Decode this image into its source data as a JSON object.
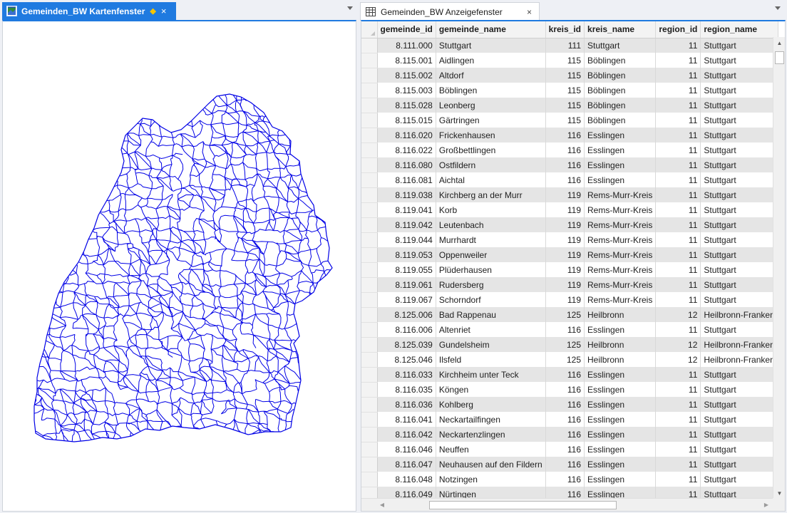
{
  "map_panel": {
    "tab_title": "Gemeinden_BW Kartenfenster",
    "icons": {
      "tab_icon": "map-window-icon",
      "modified": "diamond-icon",
      "close": "close-icon",
      "menu": "chevron-down-icon"
    },
    "close_glyph": "×",
    "pin_glyph": "◆",
    "colors": {
      "tab_active_bg": "#1f7ae0",
      "boundary_stroke": "#0000e6",
      "pin": "#f5c400"
    }
  },
  "table_panel": {
    "tab_title": "Gemeinden_BW Anzeigefenster",
    "icons": {
      "tab_icon": "table-icon",
      "close": "close-icon",
      "menu": "chevron-down-icon"
    },
    "close_glyph": "×",
    "columns": [
      "gemeinde_id",
      "gemeinde_name",
      "kreis_id",
      "kreis_name",
      "region_id",
      "region_name"
    ],
    "rows": [
      [
        "8.111.000",
        "Stuttgart",
        "111",
        "Stuttgart",
        "11",
        "Stuttgart"
      ],
      [
        "8.115.001",
        "Aidlingen",
        "115",
        "Böblingen",
        "11",
        "Stuttgart"
      ],
      [
        "8.115.002",
        "Altdorf",
        "115",
        "Böblingen",
        "11",
        "Stuttgart"
      ],
      [
        "8.115.003",
        "Böblingen",
        "115",
        "Böblingen",
        "11",
        "Stuttgart"
      ],
      [
        "8.115.028",
        "Leonberg",
        "115",
        "Böblingen",
        "11",
        "Stuttgart"
      ],
      [
        "8.115.015",
        "Gärtringen",
        "115",
        "Böblingen",
        "11",
        "Stuttgart"
      ],
      [
        "8.116.020",
        "Frickenhausen",
        "116",
        "Esslingen",
        "11",
        "Stuttgart"
      ],
      [
        "8.116.022",
        "Großbettlingen",
        "116",
        "Esslingen",
        "11",
        "Stuttgart"
      ],
      [
        "8.116.080",
        "Ostfildern",
        "116",
        "Esslingen",
        "11",
        "Stuttgart"
      ],
      [
        "8.116.081",
        "Aichtal",
        "116",
        "Esslingen",
        "11",
        "Stuttgart"
      ],
      [
        "8.119.038",
        "Kirchberg an der Murr",
        "119",
        "Rems-Murr-Kreis",
        "11",
        "Stuttgart"
      ],
      [
        "8.119.041",
        "Korb",
        "119",
        "Rems-Murr-Kreis",
        "11",
        "Stuttgart"
      ],
      [
        "8.119.042",
        "Leutenbach",
        "119",
        "Rems-Murr-Kreis",
        "11",
        "Stuttgart"
      ],
      [
        "8.119.044",
        "Murrhardt",
        "119",
        "Rems-Murr-Kreis",
        "11",
        "Stuttgart"
      ],
      [
        "8.119.053",
        "Oppenweiler",
        "119",
        "Rems-Murr-Kreis",
        "11",
        "Stuttgart"
      ],
      [
        "8.119.055",
        "Plüderhausen",
        "119",
        "Rems-Murr-Kreis",
        "11",
        "Stuttgart"
      ],
      [
        "8.119.061",
        "Rudersberg",
        "119",
        "Rems-Murr-Kreis",
        "11",
        "Stuttgart"
      ],
      [
        "8.119.067",
        "Schorndorf",
        "119",
        "Rems-Murr-Kreis",
        "11",
        "Stuttgart"
      ],
      [
        "8.125.006",
        "Bad Rappenau",
        "125",
        "Heilbronn",
        "12",
        "Heilbronn-Franken"
      ],
      [
        "8.116.006",
        "Altenriet",
        "116",
        "Esslingen",
        "11",
        "Stuttgart"
      ],
      [
        "8.125.039",
        "Gundelsheim",
        "125",
        "Heilbronn",
        "12",
        "Heilbronn-Franken"
      ],
      [
        "8.125.046",
        "Ilsfeld",
        "125",
        "Heilbronn",
        "12",
        "Heilbronn-Franken"
      ],
      [
        "8.116.033",
        "Kirchheim unter Teck",
        "116",
        "Esslingen",
        "11",
        "Stuttgart"
      ],
      [
        "8.116.035",
        "Köngen",
        "116",
        "Esslingen",
        "11",
        "Stuttgart"
      ],
      [
        "8.116.036",
        "Kohlberg",
        "116",
        "Esslingen",
        "11",
        "Stuttgart"
      ],
      [
        "8.116.041",
        "Neckartailfingen",
        "116",
        "Esslingen",
        "11",
        "Stuttgart"
      ],
      [
        "8.116.042",
        "Neckartenzlingen",
        "116",
        "Esslingen",
        "11",
        "Stuttgart"
      ],
      [
        "8.116.046",
        "Neuffen",
        "116",
        "Esslingen",
        "11",
        "Stuttgart"
      ],
      [
        "8.116.047",
        "Neuhausen auf den Fildern",
        "116",
        "Esslingen",
        "11",
        "Stuttgart"
      ],
      [
        "8.116.048",
        "Notzingen",
        "116",
        "Esslingen",
        "11",
        "Stuttgart"
      ],
      [
        "8.116.049",
        "Nürtingen",
        "116",
        "Esslingen",
        "11",
        "Stuttgart"
      ]
    ],
    "scroll_glyphs": {
      "up": "▲",
      "down": "▼",
      "left": "◀",
      "right": "▶"
    }
  }
}
